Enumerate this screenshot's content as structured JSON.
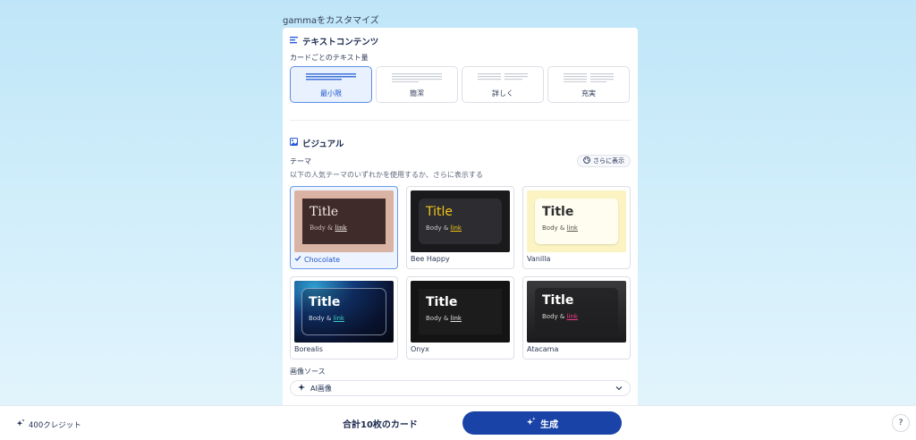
{
  "page_heading": "gammaをカスタマイズ",
  "text_content": {
    "section_title": "テキストコンテンツ",
    "amount_label": "カードごとのテキスト量",
    "options": [
      {
        "label": "最小限",
        "selected": true
      },
      {
        "label": "簡潔",
        "selected": false
      },
      {
        "label": "詳しく",
        "selected": false
      },
      {
        "label": "充実",
        "selected": false
      }
    ]
  },
  "visual": {
    "section_title": "ビジュアル",
    "theme_label": "テーマ",
    "theme_desc": "以下の人気テーマのいずれかを使用するか、さらに表示する",
    "show_more": "さらに表示",
    "themes": [
      {
        "name": "Chocolate",
        "title": "Title",
        "body": "Body &",
        "link": "link",
        "selected": true
      },
      {
        "name": "Bee Happy",
        "title": "Title",
        "body": "Body &",
        "link": "link",
        "selected": false
      },
      {
        "name": "Vanilla",
        "title": "Title",
        "body": "Body &",
        "link": "link",
        "selected": false
      },
      {
        "name": "Borealis",
        "title": "Title",
        "body": "Body &",
        "link": "link",
        "selected": false
      },
      {
        "name": "Onyx",
        "title": "Title",
        "body": "Body &",
        "link": "link",
        "selected": false
      },
      {
        "name": "Atacama",
        "title": "Title",
        "body": "Body &",
        "link": "link",
        "selected": false
      }
    ],
    "image_source_label": "画像ソース",
    "image_source_value": "AI画像"
  },
  "bottom": {
    "credits": "400クレジット",
    "card_total": "合計10枚のカード",
    "generate": "生成",
    "help": "?"
  },
  "colors": {
    "accent": "#1a43a8",
    "selected_border": "#5b8fe6"
  }
}
